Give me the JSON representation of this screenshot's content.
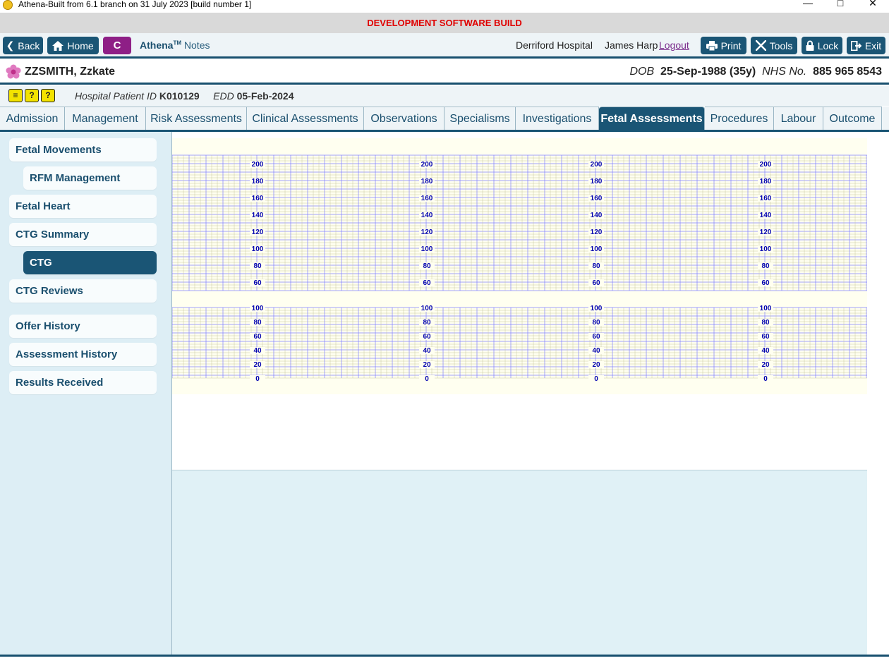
{
  "window": {
    "title": "Athena-Built from 6.1 branch on 31 July 2023 [build number 1]"
  },
  "banner": {
    "text": "DEVELOPMENT SOFTWARE BUILD"
  },
  "toolbar": {
    "back_label": "Back",
    "home_label": "Home",
    "c_label": "C",
    "brand": "Athena",
    "brand_tm": "TM",
    "brand_notes": "Notes",
    "hospital": "Derriford Hospital",
    "user": "James Harp",
    "logout_label": "Logout",
    "print_label": "Print",
    "tools_label": "Tools",
    "lock_label": "Lock",
    "exit_label": "Exit"
  },
  "patient": {
    "name": "ZZSMITH, Zzkate",
    "dob_label": "DOB",
    "dob_value": "25-Sep-1988 (35y)",
    "nhs_label": "NHS No.",
    "nhs_value": "885 965 8543",
    "hospital_id_label": "Hospital Patient ID",
    "hospital_id_value": "K010129",
    "edd_label": "EDD",
    "edd_value": "05-Feb-2024"
  },
  "tabs": [
    {
      "label": "Admission"
    },
    {
      "label": "Management"
    },
    {
      "label": "Risk Assessments"
    },
    {
      "label": "Clinical Assessments"
    },
    {
      "label": "Observations"
    },
    {
      "label": "Specialisms"
    },
    {
      "label": "Investigations"
    },
    {
      "label": "Fetal Assessments",
      "active": true
    },
    {
      "label": "Procedures"
    },
    {
      "label": "Labour"
    },
    {
      "label": "Outcome"
    }
  ],
  "sidebar": {
    "items": [
      {
        "label": "Fetal Movements"
      },
      {
        "label": "RFM Management"
      },
      {
        "label": "Fetal Heart"
      },
      {
        "label": "CTG Summary"
      },
      {
        "label": "CTG",
        "active": true
      },
      {
        "label": "CTG Reviews"
      },
      {
        "label": "Offer History"
      },
      {
        "label": "Assessment History"
      },
      {
        "label": "Results Received"
      }
    ]
  },
  "ctg": {
    "heart_rate_ticks": [
      "200",
      "180",
      "160",
      "140",
      "120",
      "100",
      "80",
      "60"
    ],
    "toco_ticks": [
      "100",
      "80",
      "60",
      "40",
      "20",
      "0"
    ],
    "grid_color_major": "#8080ff",
    "grid_color_minor": "#c8c8a0",
    "label_color": "#0000b0"
  },
  "colors": {
    "primary": "#1a5575",
    "accent": "#8e1f86",
    "banner_text": "#e00000",
    "alert_yellow": "#f3e300"
  }
}
